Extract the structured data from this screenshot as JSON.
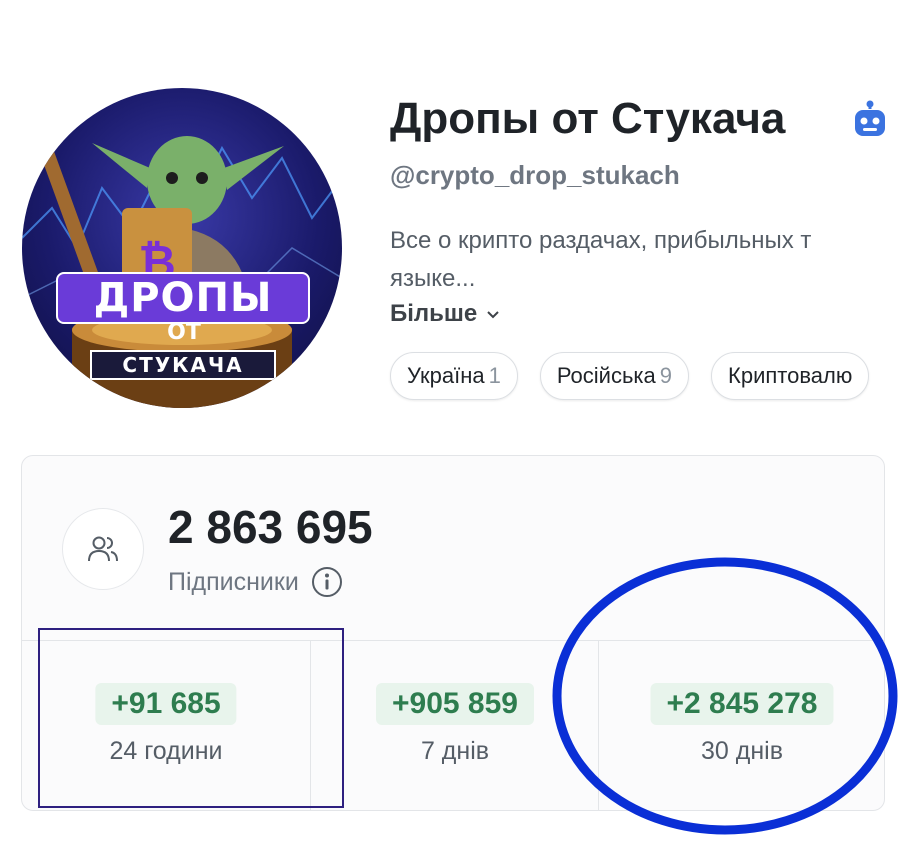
{
  "avatar": {
    "title": "ДРОПЫ",
    "middle": "ОТ",
    "subtitle": "СТУКАЧА",
    "icon": "bitcoin-icon"
  },
  "channel": {
    "name": "Дропы от Стукача",
    "bot_icon": "robot-icon",
    "handle": "@crypto_drop_stukach",
    "description_line1": "Все о крипто раздачах, прибыльных т",
    "description_line2": "языке...",
    "more_label": "Більше",
    "tags": [
      {
        "label": "Україна",
        "count": "1"
      },
      {
        "label": "Російська",
        "count": "9"
      },
      {
        "label": "Криптовалю",
        "count": ""
      }
    ]
  },
  "stats": {
    "subscribers": "2 863 695",
    "subscribers_label": "Підписники",
    "periods": [
      {
        "delta": "+91 685",
        "label": "24 години"
      },
      {
        "delta": "+905 859",
        "label": "7 днів"
      },
      {
        "delta": "+2 845 278",
        "label": "30 днів"
      }
    ]
  },
  "colors": {
    "accent_green": "#2e7d4f",
    "badge_bg": "#e8f4ec",
    "highlight_rect": "#2e2080",
    "highlight_oval": "#0a2fd6"
  }
}
